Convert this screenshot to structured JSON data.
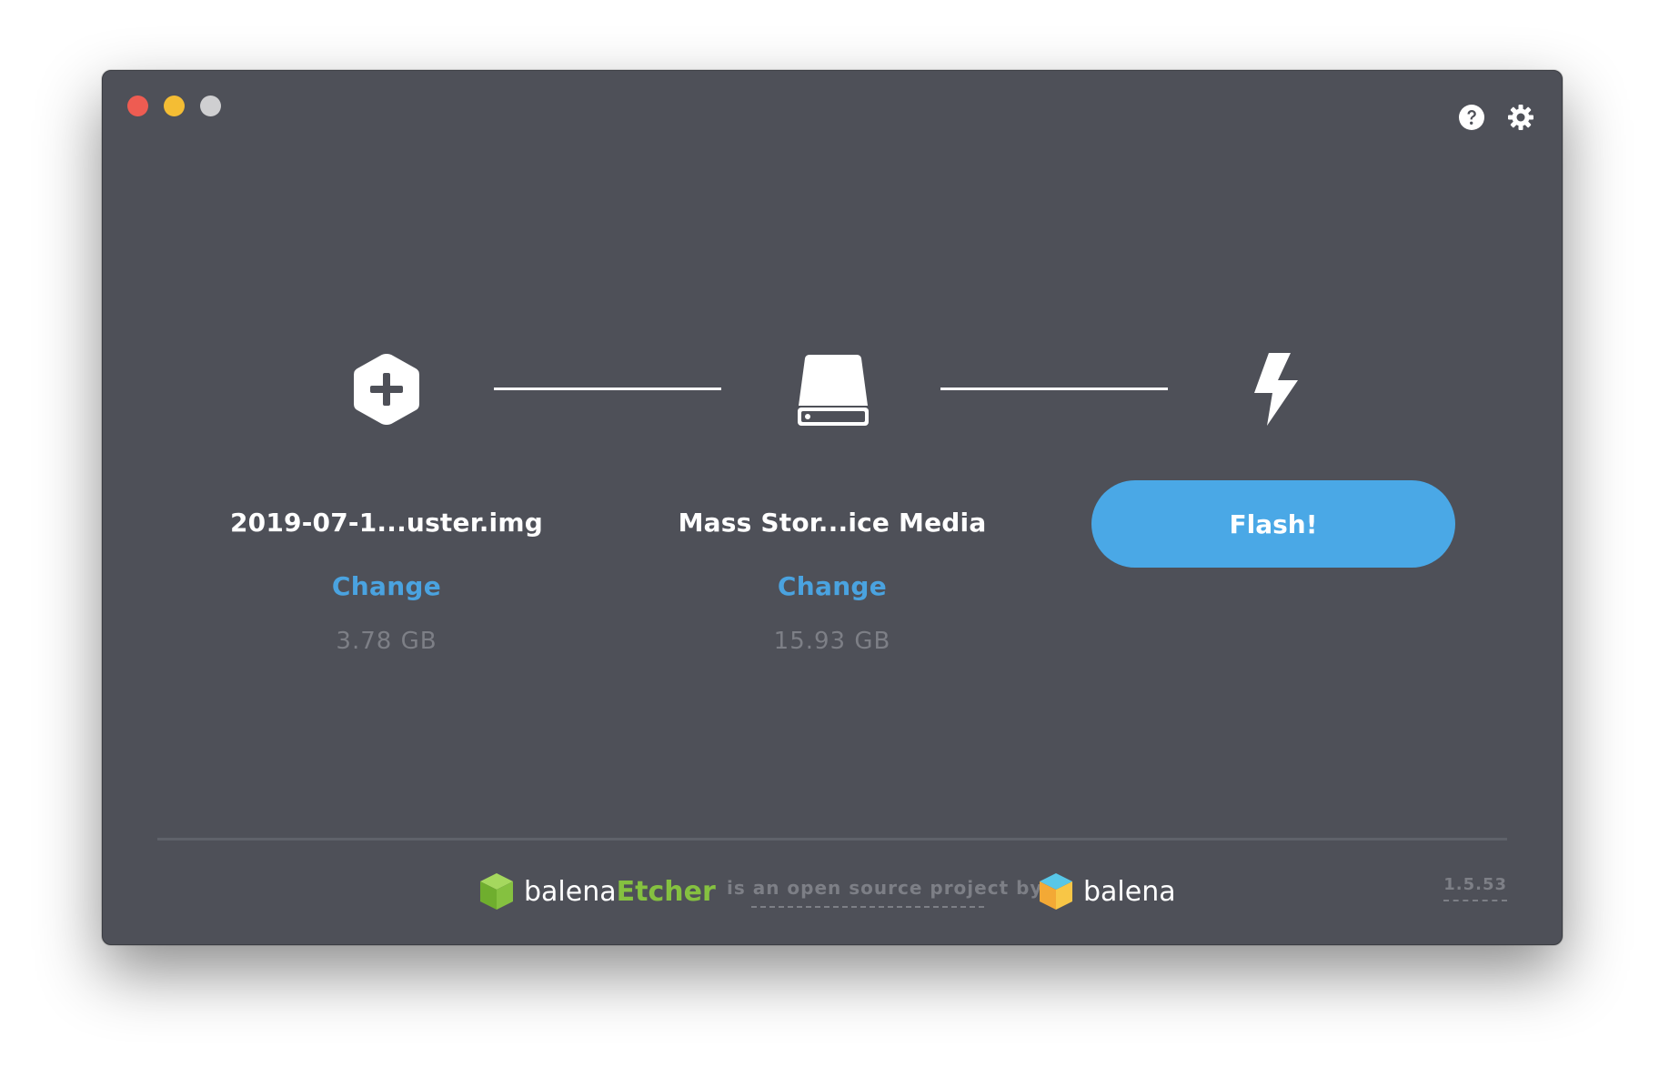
{
  "window": {
    "controls": [
      "close",
      "minimize",
      "maximize"
    ]
  },
  "header": {
    "icons": [
      "help-icon",
      "settings-icon"
    ]
  },
  "steps": [
    {
      "icon": "image-add-icon",
      "title": "2019-07-1...uster.img",
      "action_label": "Change",
      "size": "3.78 GB"
    },
    {
      "icon": "drive-icon",
      "title": "Mass Stor...ice Media",
      "action_label": "Change",
      "size": "15.93 GB"
    },
    {
      "icon": "flash-icon",
      "button_label": "Flash!"
    }
  ],
  "footer": {
    "etcher_brand_prefix": "balena",
    "etcher_brand_suffix": "Etcher",
    "tagline": "is an open source project by",
    "balena_brand": "balena",
    "version": "1.5.53"
  },
  "colors": {
    "window_bg": "#4e5058",
    "accent_blue": "#4aa8e6",
    "link_blue": "#4aa3e0",
    "etcher_green": "#85c140",
    "muted_text": "#7d7f86"
  }
}
